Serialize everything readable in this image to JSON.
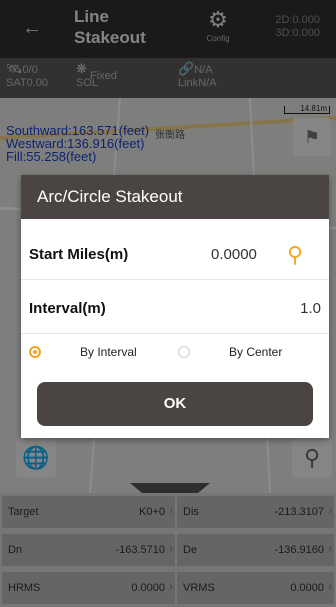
{
  "header": {
    "back_icon": "arrow-left-icon",
    "title_line1": "Line",
    "title_line2": "Stakeout",
    "config_label": "Config",
    "dim_2d": "2D:0.000",
    "dim_3d": "3D:0.000"
  },
  "status": {
    "sat_count": "0/0",
    "sat_label": "SAT",
    "sat_value": "0.00",
    "sol_label": "SOL",
    "sol_value": "Fixed",
    "link_top": "N/A",
    "link_label": "Link",
    "link_value": "N/A"
  },
  "map": {
    "southward": "Southward:163.571(feet)",
    "westward": "Westward:136.916(feet)",
    "fill": "Fill:55.258(feet)",
    "road_label": "张衡路",
    "scale": "14.81m"
  },
  "dialog": {
    "title": "Arc/Circle Stakeout",
    "start_miles_label": "Start Miles(m)",
    "start_miles_value": "0.0000",
    "interval_label": "Interval(m)",
    "interval_value": "1.0",
    "by_interval_label": "By Interval",
    "by_center_label": "By Center",
    "ok_label": "OK",
    "accent_color": "#f5a623"
  },
  "info": {
    "target_label": "Target",
    "target_value": "K0+0",
    "dis_label": "Dis",
    "dis_value": "-213.3107",
    "dn_label": "Dn",
    "dn_value": "-163.5710",
    "de_label": "De",
    "de_value": "-136.9160",
    "hrms_label": "HRMS",
    "hrms_value": "0.0000",
    "vrms_label": "VRMS",
    "vrms_value": "0.0000"
  }
}
